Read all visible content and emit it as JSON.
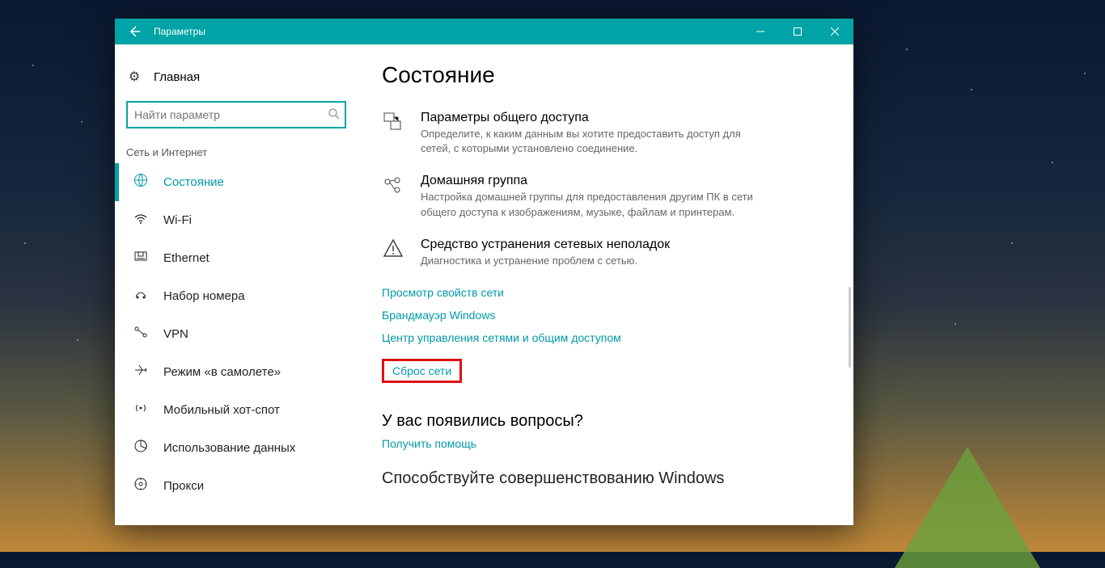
{
  "colors": {
    "accent": "#00a4a6",
    "link": "#0099a8",
    "highlight_border": "#d11"
  },
  "titlebar": {
    "title": "Параметры"
  },
  "sidebar": {
    "home": "Главная",
    "search_placeholder": "Найти параметр",
    "section": "Сеть и Интернет",
    "items": [
      {
        "icon": "globe-icon",
        "label": "Состояние",
        "selected": true
      },
      {
        "icon": "wifi-icon",
        "label": "Wi-Fi",
        "selected": false
      },
      {
        "icon": "ethernet-icon",
        "label": "Ethernet",
        "selected": false
      },
      {
        "icon": "dialup-icon",
        "label": "Набор номера",
        "selected": false
      },
      {
        "icon": "vpn-icon",
        "label": "VPN",
        "selected": false
      },
      {
        "icon": "airplane-icon",
        "label": "Режим «в самолете»",
        "selected": false
      },
      {
        "icon": "hotspot-icon",
        "label": "Мобильный хот-спот",
        "selected": false
      },
      {
        "icon": "datausage-icon",
        "label": "Использование данных",
        "selected": false
      },
      {
        "icon": "proxy-icon",
        "label": "Прокси",
        "selected": false
      }
    ]
  },
  "content": {
    "heading": "Состояние",
    "options": [
      {
        "icon": "sharing-icon",
        "title": "Параметры общего доступа",
        "desc": "Определите, к каким данным вы хотите предоставить доступ для сетей, с которыми установлено соединение."
      },
      {
        "icon": "homegroup-icon",
        "title": "Домашняя группа",
        "desc": "Настройка домашней группы для предоставления другим ПК в сети общего доступа к изображениям, музыке, файлам и принтерам."
      },
      {
        "icon": "troubleshoot-icon",
        "title": "Средство устранения сетевых неполадок",
        "desc": "Диагностика и устранение проблем с сетью."
      }
    ],
    "links": [
      "Просмотр свойств сети",
      "Брандмауэр Windows",
      "Центр управления сетями и общим доступом"
    ],
    "highlight_link": "Сброс сети",
    "questions_heading": "У вас появились вопросы?",
    "help_link": "Получить помощь",
    "cutoff": "Способствуйте совершенствованию Windows"
  }
}
